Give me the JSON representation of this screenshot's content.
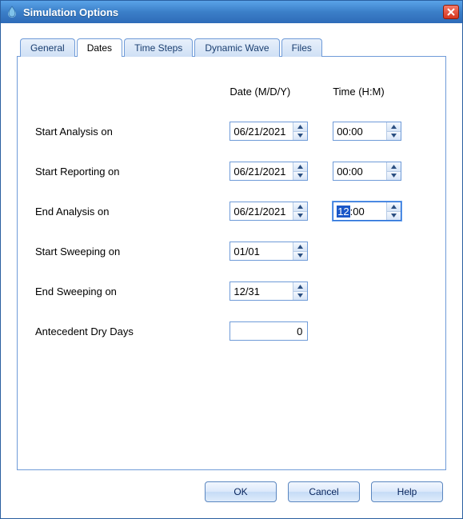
{
  "window": {
    "title": "Simulation Options"
  },
  "tabs": [
    {
      "label": "General"
    },
    {
      "label": "Dates"
    },
    {
      "label": "Time Steps"
    },
    {
      "label": "Dynamic Wave"
    },
    {
      "label": "Files"
    }
  ],
  "activeTabIndex": 1,
  "headers": {
    "date": "Date (M/D/Y)",
    "time": "Time (H:M)"
  },
  "rows": {
    "startAnalysis": {
      "label": "Start Analysis on",
      "date": "06/21/2021",
      "time": "00:00"
    },
    "startReporting": {
      "label": "Start Reporting on",
      "date": "06/21/2021",
      "time": "00:00"
    },
    "endAnalysis": {
      "label": "End Analysis on",
      "date": "06/21/2021",
      "time_sel": "12",
      "time_rest": ":00"
    },
    "startSweeping": {
      "label": "Start Sweeping on",
      "date": "01/01"
    },
    "endSweeping": {
      "label": "End Sweeping on",
      "date": "12/31"
    },
    "dryDays": {
      "label": "Antecedent Dry Days",
      "value": "0"
    }
  },
  "buttons": {
    "ok": "OK",
    "cancel": "Cancel",
    "help": "Help"
  }
}
